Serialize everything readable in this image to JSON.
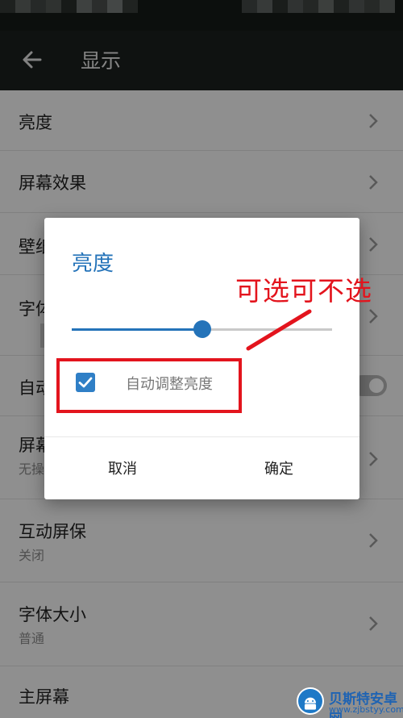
{
  "appbar": {
    "title": "显示"
  },
  "rows": [
    {
      "label": "亮度",
      "sub": ""
    },
    {
      "label": "屏幕效果",
      "sub": ""
    },
    {
      "label": "壁纸",
      "sub": ""
    },
    {
      "label": "字体",
      "sub": ""
    },
    {
      "label": "自动",
      "sub": ""
    },
    {
      "label": "屏幕",
      "sub": "无操"
    },
    {
      "label": "互动屏保",
      "sub": "关闭"
    },
    {
      "label": "字体大小",
      "sub": "普通"
    },
    {
      "label": "主屏幕",
      "sub": ""
    }
  ],
  "dialog": {
    "title": "亮度",
    "brightness_fraction": 0.5,
    "auto_checkbox": {
      "label": "自动调整亮度",
      "checked": true
    },
    "cancel_label": "取消",
    "ok_label": "确定"
  },
  "annotation": {
    "text": "可选可不选",
    "color": "#e3141d"
  },
  "watermark": {
    "name": "贝斯特安卓网",
    "url": "www.zjbstyy.com"
  },
  "colors": {
    "accent": "#2473b9",
    "appbar": "#1b201e",
    "annotation": "#e3141d"
  }
}
